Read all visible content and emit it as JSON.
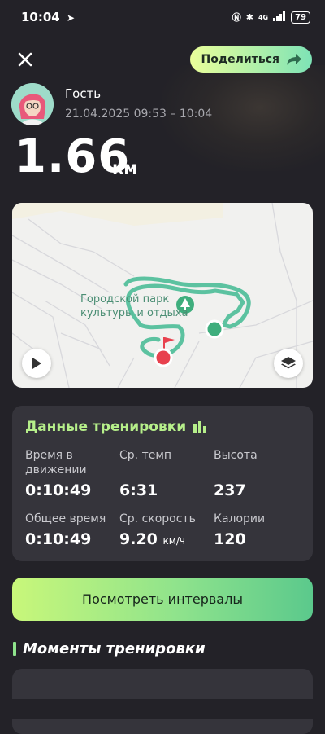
{
  "status_bar": {
    "time": "10:04",
    "network": "4G",
    "battery": "79"
  },
  "header": {
    "share_label": "Поделиться"
  },
  "user": {
    "name": "Гость",
    "datetime": "21.04.2025 09:53 – 10:04"
  },
  "distance": {
    "value": "1.66",
    "unit": "км"
  },
  "map": {
    "park_label_line1": "Городской парк",
    "park_label_line2": "культуры и отдыха"
  },
  "stats": {
    "title": "Данные тренировки",
    "items": [
      {
        "label_line1": "Время в",
        "label_line2": "движении",
        "value": "0:10:49",
        "unit": ""
      },
      {
        "label_line1": "Ср. темп",
        "label_line2": "",
        "value": "6:31",
        "unit": ""
      },
      {
        "label_line1": "Высота",
        "label_line2": "",
        "value": "237",
        "unit": ""
      },
      {
        "label_line1": "Общее время",
        "label_line2": "",
        "value": "0:10:49",
        "unit": ""
      },
      {
        "label_line1": "Ср. скорость",
        "label_line2": "",
        "value": "9.20",
        "unit": "км/ч"
      },
      {
        "label_line1": "Калории",
        "label_line2": "",
        "value": "120",
        "unit": ""
      }
    ]
  },
  "intervals_button": {
    "label": "Посмотреть интервалы"
  },
  "moments": {
    "title": "Моменты тренировки"
  },
  "colors": {
    "accent_green": "#8fe38c",
    "route": "#5cc2a0",
    "background": "#232228",
    "card": "#35343b"
  }
}
